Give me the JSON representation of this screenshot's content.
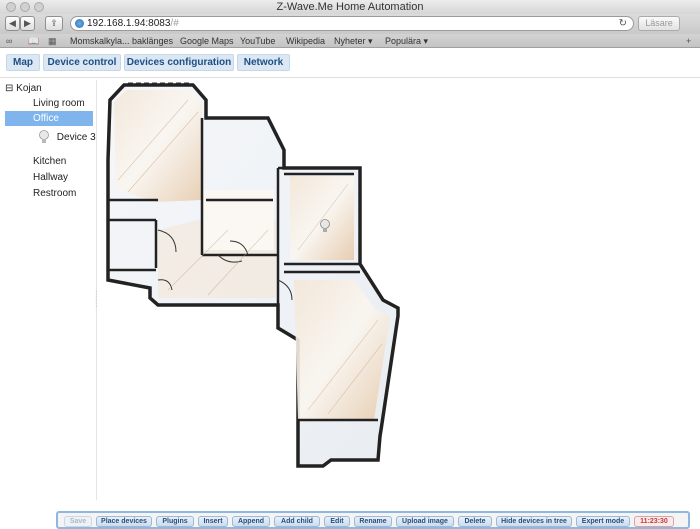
{
  "window": {
    "title": "Z-Wave.Me Home Automation"
  },
  "browser": {
    "address": "192.168.1.94:8083",
    "address_suffix": "/#",
    "reader_label": "Läsare",
    "bookmarks": [
      "Momskalkyla... baklänges",
      "Google Maps",
      "YouTube",
      "Wikipedia",
      "Nyheter ▾",
      "Populära ▾"
    ]
  },
  "tabs": [
    {
      "label": "Map"
    },
    {
      "label": "Device control"
    },
    {
      "label": "Devices configuration"
    },
    {
      "label": "Network"
    }
  ],
  "tree": {
    "root": "Kojan",
    "collapse_glyph": "⊟",
    "rooms": [
      "Living room",
      "Office",
      "Kitchen",
      "Hallway",
      "Restroom"
    ],
    "selected_room": "Office",
    "device": "Device 3"
  },
  "bottom_bar": {
    "buttons": [
      "Save",
      "Place devices",
      "Plugins",
      "Insert",
      "Append",
      "Add child",
      "Edit",
      "Rename",
      "Upload image",
      "Delete",
      "Hide devices in tree",
      "Expert mode"
    ],
    "disabled": [
      "Save"
    ],
    "clock": "11:23:30"
  },
  "colors": {
    "accent": "#1d4f86",
    "selection": "#7fb4ec",
    "clock": "#c23b3b"
  }
}
